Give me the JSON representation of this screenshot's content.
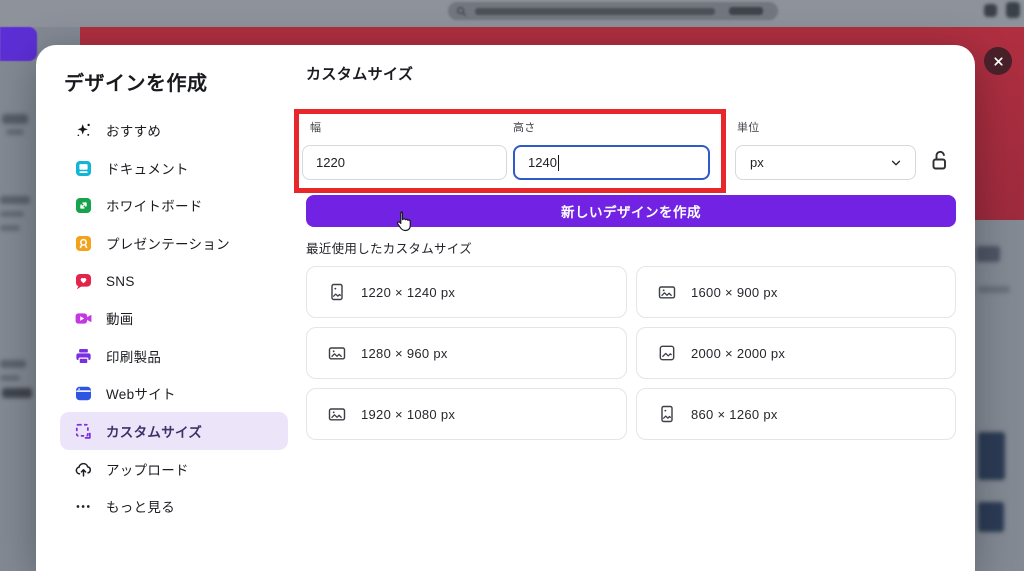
{
  "modal": {
    "title": "デザインを作成"
  },
  "sidebar": {
    "items": [
      {
        "label": "おすすめ",
        "icon": "sparkle-icon",
        "color": "#15151a",
        "selected": false
      },
      {
        "label": "ドキュメント",
        "icon": "document-icon",
        "color": "#12b5d6",
        "selected": false
      },
      {
        "label": "ホワイトボード",
        "icon": "whiteboard-icon",
        "color": "#17a24e",
        "selected": false
      },
      {
        "label": "プレゼンテーション",
        "icon": "presentation-icon",
        "color": "#f2a21d",
        "selected": false
      },
      {
        "label": "SNS",
        "icon": "sns-icon",
        "color": "#e2254b",
        "selected": false
      },
      {
        "label": "動画",
        "icon": "video-icon",
        "color": "#c438e2",
        "selected": false
      },
      {
        "label": "印刷製品",
        "icon": "print-icon",
        "color": "#7a2fe0",
        "selected": false
      },
      {
        "label": "Webサイト",
        "icon": "website-icon",
        "color": "#2e55e2",
        "selected": false
      },
      {
        "label": "カスタムサイズ",
        "icon": "custom-size-icon",
        "color": "#7a2fe0",
        "selected": true
      },
      {
        "label": "アップロード",
        "icon": "upload-cloud-icon",
        "color": "#1e1e24",
        "selected": false
      },
      {
        "label": "もっと見る",
        "icon": "more-dots-icon",
        "color": "#1e1e24",
        "selected": false
      }
    ]
  },
  "main": {
    "heading": "カスタムサイズ",
    "width_field": {
      "label": "幅",
      "value": "1220"
    },
    "height_field": {
      "label": "高さ",
      "value": "1240",
      "focused": true
    },
    "unit_field": {
      "label": "単位",
      "value": "px"
    },
    "create_button_label": "新しいデザインを作成",
    "recent_heading": "最近使用したカスタムサイズ",
    "recent_sizes": [
      {
        "label": "1220 × 1240 px",
        "orientation": "portrait"
      },
      {
        "label": "1600 × 900 px",
        "orientation": "landscape"
      },
      {
        "label": "1280 × 960 px",
        "orientation": "landscape"
      },
      {
        "label": "2000 × 2000 px",
        "orientation": "square"
      },
      {
        "label": "1920 × 1080 px",
        "orientation": "landscape"
      },
      {
        "label": "860 × 1260 px",
        "orientation": "portrait"
      }
    ]
  },
  "colors": {
    "accent_purple": "#7122e3",
    "annotation_red": "#e8272b",
    "focus_blue": "#2f5bc9",
    "selected_item_bg": "#ece5fa",
    "banner_red": "#a82c3e",
    "background_gray": "#838a94"
  }
}
